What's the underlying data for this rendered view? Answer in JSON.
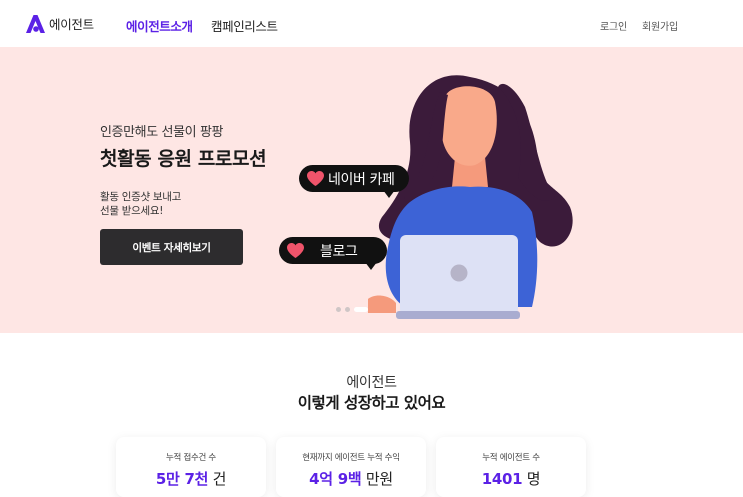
{
  "header": {
    "logo_text": "에이전트",
    "nav": [
      "에이전트소개",
      "캠페인리스트"
    ],
    "login": "로그인",
    "signup": "회원가입"
  },
  "hero": {
    "subtitle": "인증만해도 선물이 팡팡",
    "title": "첫활동 응원 프로모션",
    "desc_line1": "활동 인증샷 보내고",
    "desc_line2": "선물 받으세요!",
    "button": "이벤트 자세히보기",
    "bubble_naver": "네이버 카페",
    "bubble_blog": "블로그",
    "slide_count": 3,
    "active_slide": 3
  },
  "stats": {
    "heading1": "에이전트",
    "heading2": "이렇게 성장하고 있어요",
    "cards": [
      {
        "label": "누적 접수건 수",
        "num": "5만 7천",
        "unit": " 건"
      },
      {
        "label": "현재까지 에이전트 누적 수익",
        "num": "4억 9백",
        "unit": " 만원"
      },
      {
        "label": "누적 에이전트 수",
        "num": "1401",
        "unit": " 명"
      }
    ]
  },
  "colors": {
    "accent": "#5b21e6",
    "hero_bg": "#fee6e4",
    "button_bg": "#2d2c2e",
    "hair": "#3b1b3a",
    "shirt": "#3d63d6",
    "skin": "#f9a98a",
    "laptop": "#dde1f5",
    "heart": "#f0546b"
  },
  "icons": {
    "logo": "brand-a-logo-icon",
    "heart": "heart-icon"
  }
}
